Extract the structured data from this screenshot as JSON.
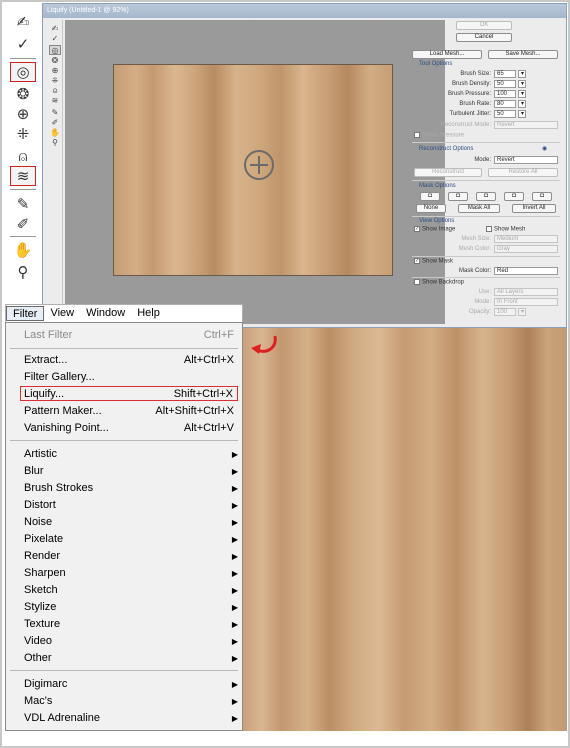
{
  "liquify": {
    "title": "Liquify (Untitled-1 @ 92%)",
    "buttons": {
      "ok": "OK",
      "cancel": "Cancel",
      "load_mesh": "Load Mesh...",
      "save_mesh": "Save Mesh..."
    },
    "tool_options": {
      "header": "Tool Options",
      "brush_size_label": "Brush Size:",
      "brush_size": "65",
      "brush_density_label": "Brush Density:",
      "brush_density": "50",
      "brush_pressure_label": "Brush Pressure:",
      "brush_pressure": "100",
      "brush_rate_label": "Brush Rate:",
      "brush_rate": "80",
      "turbulent_jitter_label": "Turbulent Jitter:",
      "turbulent_jitter": "50",
      "reconstruct_mode_label": "Reconstruct Mode:",
      "reconstruct_mode": "Revert",
      "stylus_pressure": "Stylus Pressure"
    },
    "reconstruct_options": {
      "header": "Reconstruct Options",
      "mode_label": "Mode:",
      "mode": "Revert",
      "reconstruct": "Reconstruct",
      "restore_all": "Restore All"
    },
    "mask_options": {
      "header": "Mask Options",
      "none": "None",
      "mask_all": "Mask All",
      "invert_all": "Invert All"
    },
    "view_options": {
      "header": "View Options",
      "show_image": "Show Image",
      "show_mesh": "Show Mesh",
      "mesh_size_label": "Mesh Size:",
      "mesh_size": "Medium",
      "mesh_color_label": "Mesh Color:",
      "mesh_color": "Gray",
      "show_mask": "Show Mask",
      "mask_color_label": "Mask Color:",
      "mask_color": "Red",
      "show_backdrop": "Show Backdrop",
      "use_label": "Use:",
      "use": "All Layers",
      "mode_label": "Mode:",
      "mode": "In Front",
      "opacity_label": "Opacity:",
      "opacity": "100"
    }
  },
  "menubar": [
    "Filter",
    "View",
    "Window",
    "Help"
  ],
  "menu": {
    "last_filter": {
      "label": "Last Filter",
      "shortcut": "Ctrl+F"
    },
    "group1": [
      {
        "label": "Extract...",
        "shortcut": "Alt+Ctrl+X"
      },
      {
        "label": "Filter Gallery...",
        "shortcut": ""
      },
      {
        "label": "Liquify...",
        "shortcut": "Shift+Ctrl+X"
      },
      {
        "label": "Pattern Maker...",
        "shortcut": "Alt+Shift+Ctrl+X"
      },
      {
        "label": "Vanishing Point...",
        "shortcut": "Alt+Ctrl+V"
      }
    ],
    "group2": [
      "Artistic",
      "Blur",
      "Brush Strokes",
      "Distort",
      "Noise",
      "Pixelate",
      "Render",
      "Sharpen",
      "Sketch",
      "Stylize",
      "Texture",
      "Video",
      "Other"
    ],
    "group3": [
      "Digimarc",
      "Mac's",
      "VDL Adrenaline"
    ]
  },
  "colors": {
    "highlight_border": "#d83030",
    "wood_light": "#dbb790",
    "wood_dark": "#b6895f"
  }
}
